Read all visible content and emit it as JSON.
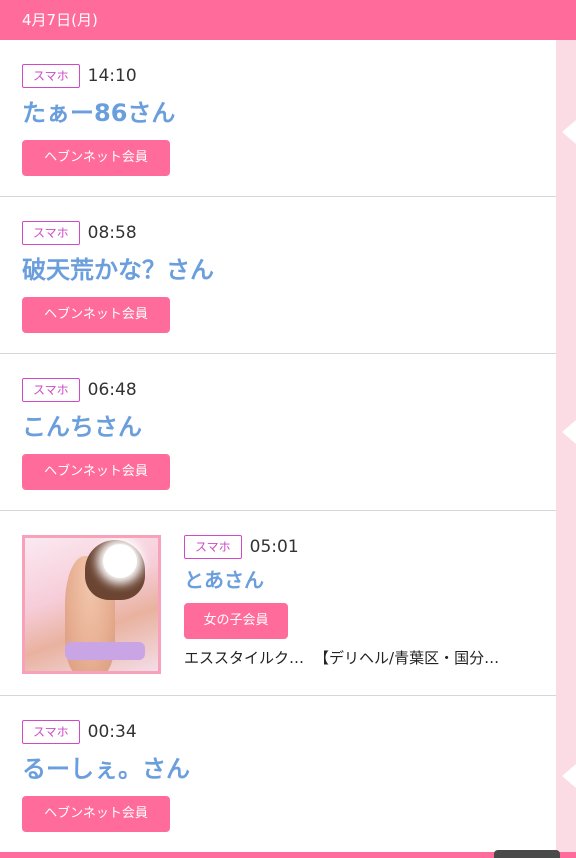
{
  "header": {
    "date": "4月7日(月)"
  },
  "entries": [
    {
      "device": "スマホ",
      "time": "14:10",
      "name": "たぁー86さん",
      "member": "ヘブンネット会員"
    },
    {
      "device": "スマホ",
      "time": "08:58",
      "name": "破天荒かな？さん",
      "member": "ヘブンネット会員"
    },
    {
      "device": "スマホ",
      "time": "06:48",
      "name": "こんちさん",
      "member": "ヘブンネット会員"
    },
    {
      "device": "スマホ",
      "time": "05:01",
      "name": "とあさん",
      "member": "女の子会員",
      "shop": "エススタイルク…",
      "area": "【デリヘル/青葉区・国分…"
    },
    {
      "device": "スマホ",
      "time": "00:34",
      "name": "るーしぇ。さん",
      "member": "ヘブンネット会員"
    }
  ],
  "colors": {
    "accent": "#ff6b9a",
    "name": "#6a9edc",
    "device_badge": "#d049c6"
  }
}
